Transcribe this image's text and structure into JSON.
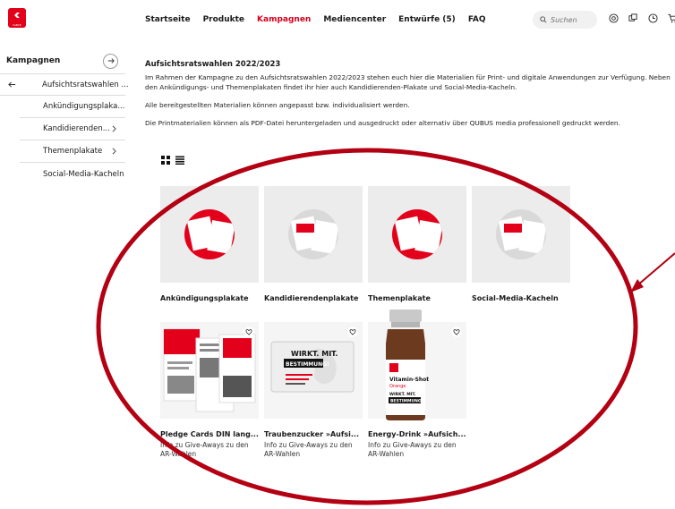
{
  "brand": {
    "logo_text": "IGBCE",
    "accent": "#e3001b"
  },
  "nav": {
    "items": [
      {
        "label": "Startseite",
        "active": false
      },
      {
        "label": "Produkte",
        "active": false
      },
      {
        "label": "Kampagnen",
        "active": true
      },
      {
        "label": "Mediencenter",
        "active": false
      },
      {
        "label": "Entwürfe (5)",
        "active": false
      },
      {
        "label": "FAQ",
        "active": false
      }
    ]
  },
  "search": {
    "placeholder": "Suchen",
    "icon": "search-icon"
  },
  "top_icons": [
    "at-icon",
    "copy-icon",
    "clock-icon",
    "cart-icon"
  ],
  "sidebar": {
    "title": "Kampagnen",
    "items": [
      {
        "label": "Aufsichtsratswahlen ...",
        "back": true
      },
      {
        "label": "Ankündigungsplaka...",
        "chevron": false
      },
      {
        "label": "Kandidierenden...",
        "chevron": true
      },
      {
        "label": "Themenplakate",
        "chevron": true
      },
      {
        "label": "Social-Media-Kacheln",
        "chevron": false
      }
    ]
  },
  "main": {
    "title": "Aufsichtsratswahlen 2022/2023",
    "paragraphs": [
      "Im Rahmen der Kampagne zu den Aufsichtsratswahlen 2022/2023 stehen euch hier die Materialien für Print- und digitale Anwendungen zur Verfügung. Neben den Ankündigungs- und Themenplakaten findet ihr hier auch Kandidierenden-Plakate und Social-Media-Kacheln.",
      "Alle bereitgestellten Materialien können angepasst bzw. individualisiert werden.",
      "Die Printmaterialien können als PDF-Datei heruntergeladen und ausgedruckt oder alternativ über QUBUS media professionell gedruckt werden."
    ],
    "view_modes": [
      "grid-view-icon",
      "list-view-icon"
    ],
    "categories": [
      {
        "title": "Ankündigungsplakate"
      },
      {
        "title": "Kandidierendenplakate"
      },
      {
        "title": "Themenplakate"
      },
      {
        "title": "Social-Media-Kacheln"
      }
    ],
    "products": [
      {
        "title": "Pledge Cards DIN lang...",
        "subtitle": "Info zu Give-Aways zu den AR-Wahlen"
      },
      {
        "title": "Traubenzucker »Aufsi...",
        "subtitle": "Info zu Give-Aways zu den AR-Wahlen"
      },
      {
        "title": "Energy-Drink »Aufsich...",
        "subtitle": "Info zu Give-Aways zu den AR-Wahlen"
      }
    ],
    "product_texts": {
      "candy_line1": "WIRKT. MIT.",
      "candy_line2": "BESTIMMUNG!",
      "bottle_label1": "Vitamin-Shot",
      "bottle_label2": "Orange",
      "bottle_label3": "WIRKT. MIT.",
      "bottle_label4": "BESTIMMUNG!"
    }
  },
  "annotation": {
    "color": "#b30012"
  }
}
